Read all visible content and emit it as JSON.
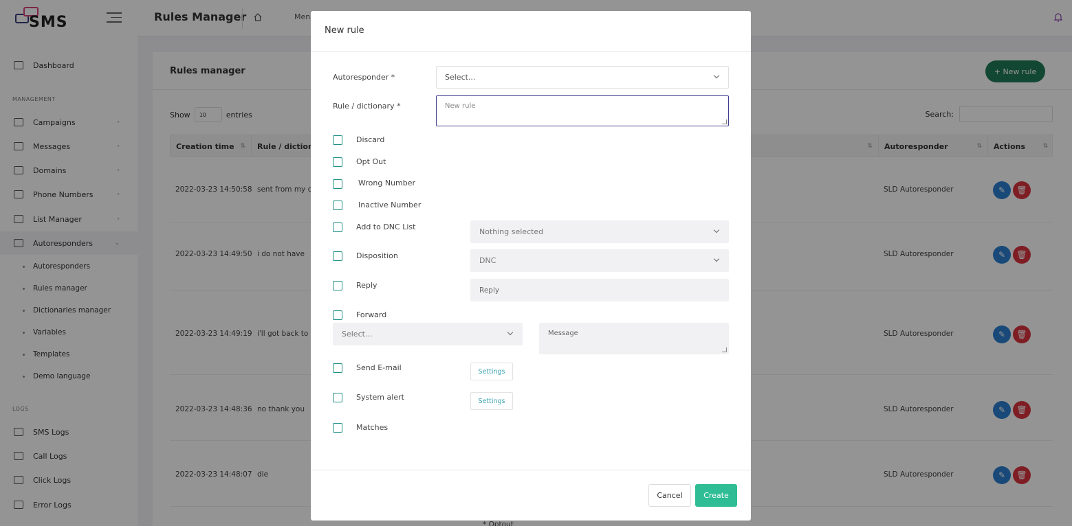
{
  "app": {
    "logo_text": "SMS",
    "page_title": "Rules Manager",
    "menu_text": "Men"
  },
  "sidebar": {
    "dashboard": "Dashboard",
    "management_label": "MANAGEMENT",
    "items": [
      {
        "label": "Campaigns",
        "icon": "megaphone-icon"
      },
      {
        "label": "Messages",
        "icon": "message-icon"
      },
      {
        "label": "Domains",
        "icon": "domain-icon"
      },
      {
        "label": "Phone Numbers",
        "icon": "phone-icon"
      },
      {
        "label": "List Manager",
        "icon": "layers-icon"
      },
      {
        "label": "Autoresponders",
        "icon": "autoresponder-icon"
      }
    ],
    "sub_items": [
      "Autoresponders",
      "Rules manager",
      "Dictionaries manager",
      "Variables",
      "Templates",
      "Demo language"
    ],
    "logs_label": "LOGS",
    "logs": [
      {
        "label": "SMS Logs",
        "icon": "sms-log-icon"
      },
      {
        "label": "Call Logs",
        "icon": "call-log-icon"
      },
      {
        "label": "Click Logs",
        "icon": "click-log-icon"
      },
      {
        "label": "Error Logs",
        "icon": "warning-icon"
      }
    ]
  },
  "content": {
    "title": "Rules manager",
    "new_rule_button": "+ New rule",
    "show_label": "Show",
    "entries_value": "10",
    "entries_label": "entries",
    "search_label": "Search:",
    "columns": [
      "Creation time",
      "Rule / dictiona",
      "Autoresponder",
      "Actions"
    ],
    "rows": [
      {
        "time": "2022-03-23 14:50:58",
        "rule": "sent from my c",
        "autoresponder": "SLD Autoresponder"
      },
      {
        "time": "2022-03-23 14:49:50",
        "rule": "i do not have",
        "autoresponder": "SLD Autoresponder"
      },
      {
        "time": "2022-03-23 14:49:19",
        "rule": "i'll got back to y",
        "autoresponder": "SLD Autoresponder"
      },
      {
        "time": "2022-03-23 14:48:36",
        "rule": "no thank you",
        "autoresponder": "SLD Autoresponder"
      },
      {
        "time": "2022-03-23 14:48:07",
        "rule": "die",
        "autoresponder": "SLD Autoresponder"
      }
    ],
    "partial_text": "* Optout"
  },
  "modal": {
    "title": "New rule",
    "autoresponder_label": "Autoresponder *",
    "autoresponder_placeholder": "Select...",
    "rule_label": "Rule / dictionary *",
    "rule_placeholder": "New rule",
    "checkboxes": {
      "discard": "Discard",
      "opt_out": "Opt Out",
      "wrong_number": "Wrong Number",
      "inactive_number": "Inactive Number",
      "add_dnc": "Add to DNC List",
      "disposition": "Disposition",
      "reply": "Reply",
      "forward": "Forward",
      "send_email": "Send E-mail",
      "system_alert": "System alert",
      "matches": "Matches"
    },
    "dnc_select": "Nothing selected",
    "disposition_select": "DNC",
    "reply_placeholder": "Reply",
    "forward_select": "Select...",
    "message_placeholder": "Message",
    "settings_label": "Settings",
    "cancel": "Cancel",
    "create": "Create"
  }
}
